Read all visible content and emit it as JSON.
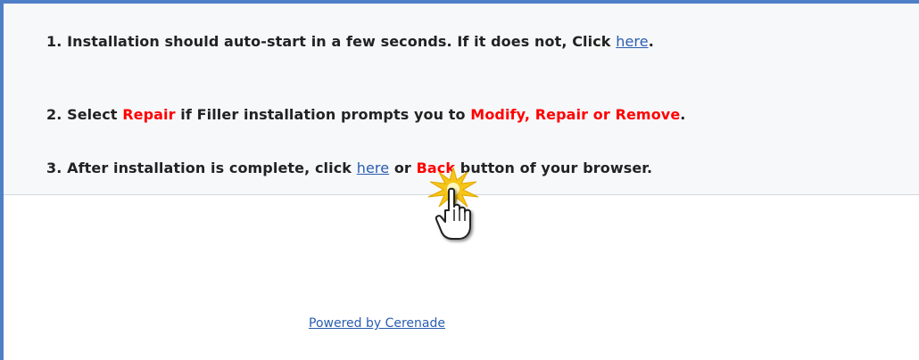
{
  "colors": {
    "frame": "#4f7fc6",
    "highlight": "#ff0000",
    "link": "#2a5db0",
    "text": "#222222"
  },
  "step1": {
    "text": "1. Installation should auto-start in a few seconds. If it does not, Click ",
    "link": "here",
    "end": "."
  },
  "step2": {
    "prefix": "2. Select ",
    "repair": "Repair",
    "middle": " if Filler installation prompts you to ",
    "options": "Modify, Repair or Remove",
    "end": "."
  },
  "step3": {
    "prefix": "3. After installation is complete, click ",
    "link": "here",
    "middle": " or ",
    "back": "Back",
    "suffix": " button of your browser."
  },
  "footer": {
    "powered_by": "Powered by Cerenade"
  },
  "cursor": {
    "icon": "hand-pointer-click-icon"
  }
}
